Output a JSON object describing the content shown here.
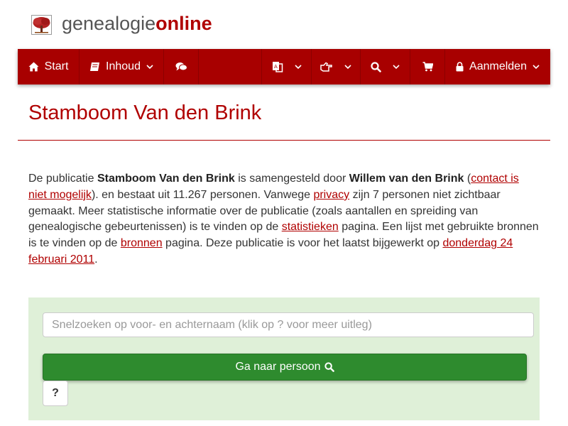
{
  "site": {
    "name_part1": "genealogie",
    "name_part2": "online",
    "logo_icon": "tree-logo"
  },
  "navbar": {
    "start_label": "Start",
    "inhoud_label": "Inhoud",
    "login_label": "Aanmelden",
    "icons": [
      "home-icon",
      "book-icon",
      "comments-icon",
      "language-icon",
      "hand-pointer-icon",
      "search-icon",
      "shopping-cart-icon",
      "lock-icon"
    ]
  },
  "page": {
    "title": "Stamboom Van den Brink"
  },
  "intro": {
    "t1": "De publicatie ",
    "pub_name": "Stamboom Van den Brink",
    "t2": " is samengesteld door ",
    "author": "Willem van den Brink",
    "t3": " (",
    "contact_link": "contact is niet mogelijk",
    "t4": "). en bestaat uit 11.267 personen. Vanwege ",
    "privacy_link": "privacy",
    "t5": " zijn 7 personen niet zichtbaar gemaakt. Meer statistische informatie over de publicatie (zoals aantallen en spreiding van genealogische gebeurtenissen) is te vinden op de ",
    "stats_link": "statistieken",
    "t6": " pagina. Een lijst met gebruikte bronnen is te vinden op de ",
    "sources_link": "bronnen",
    "t7": " pagina. Deze publicatie is voor het laatst bijgewerkt op ",
    "date_link": "donderdag 24 februari 2011",
    "t8": "."
  },
  "search": {
    "placeholder": "Snelzoeken op voor- en achternaam (klik op ? voor meer uitleg)",
    "button_label": "Ga naar persoon",
    "help_label": "?"
  },
  "colors": {
    "brand_red": "#a80000",
    "panel_green": "#dff0d8",
    "button_green": "#2e8b2e"
  }
}
